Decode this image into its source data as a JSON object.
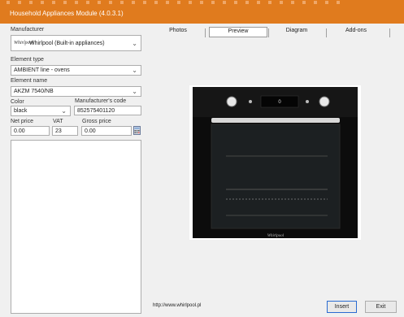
{
  "window": {
    "title": "Household Appliances Module (4.0.3.1)"
  },
  "form": {
    "manufacturer_label": "Manufacturer",
    "manufacturer_logo": "Whirlpool",
    "manufacturer_value": "Whirlpool (Built-in appliances)",
    "element_type_label": "Element type",
    "element_type_value": "AMBIENT line - ovens",
    "element_name_label": "Element name",
    "element_name_value": "AKZM 7540/NB",
    "color_label": "Color",
    "color_value": "black",
    "manufacturer_code_label": "Manufacturer's code",
    "manufacturer_code_value": "852575401120",
    "net_price_label": "Net price",
    "net_price_value": "0.00",
    "vat_label": "VAT",
    "vat_value": "23",
    "gross_price_label": "Gross price",
    "gross_price_value": "0.00",
    "calculator_icon": "calculator-icon"
  },
  "tabs": [
    {
      "label": "Photos",
      "selected": false
    },
    {
      "label": "Preview",
      "selected": true
    },
    {
      "label": "Diagram",
      "selected": false
    },
    {
      "label": "Add-ons",
      "selected": false
    }
  ],
  "preview": {
    "image": "oven-photo",
    "display_readout": "0",
    "brand_on_oven": "Whirlpool"
  },
  "footer": {
    "url": "http://www.whirlpool.pl",
    "insert_label": "Insert",
    "exit_label": "Exit"
  },
  "colors": {
    "titlebar": "#e07b1e",
    "window_bg": "#f0f0f0",
    "selected_button_border": "#2a6bd1"
  }
}
